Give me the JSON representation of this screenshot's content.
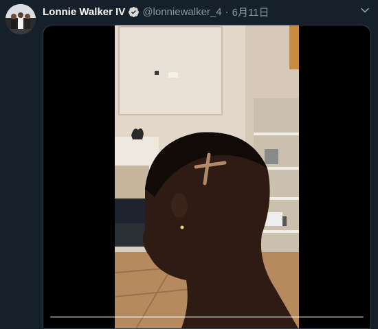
{
  "tweet": {
    "author": {
      "display_name": "Lonnie Walker IV",
      "handle": "@lonniewalker_4",
      "verified": true,
      "avatar": "avatar-photo"
    },
    "separator": "·",
    "date": "6月11日",
    "menu_icon": "chevron-down-icon",
    "media": {
      "type": "video",
      "progress": 0.0
    }
  },
  "colors": {
    "background": "#15202b",
    "secondary_text": "#8899a6",
    "verified_blue": "#1da1f2"
  }
}
